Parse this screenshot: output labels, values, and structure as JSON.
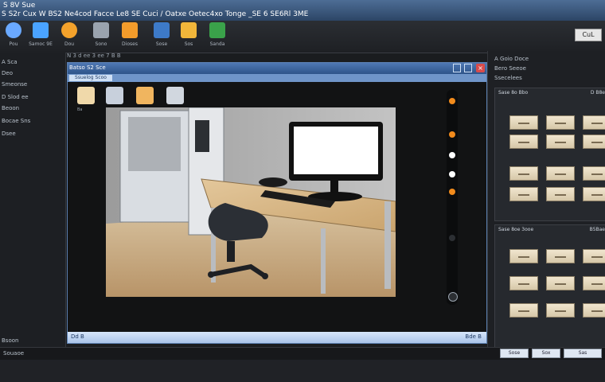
{
  "window": {
    "title": "S 8V Sue",
    "menu": "S S2r Cux W BS2 Ne4cod Facce Le8 SE Cuci / Oatxe Oetec4xo Tonge _SE 6 SE6Rl 3ME"
  },
  "toolbar": {
    "right_button": "CuL",
    "items": [
      {
        "label": "Pou",
        "icon": "globe-icon",
        "color": "#6aa9ff"
      },
      {
        "label": "Samoc 9E",
        "icon": "picture-icon",
        "color": "#4aa3ff"
      },
      {
        "label": "Dou",
        "icon": "orange-icon",
        "color": "#f4a22b"
      },
      {
        "label": "Sono",
        "icon": "printer-icon",
        "color": "#9aa3ae"
      },
      {
        "label": "Dioses",
        "icon": "chart-icon",
        "color": "#f39c2b"
      },
      {
        "label": "Sose",
        "icon": "gear-icon",
        "color": "#3d7ac8"
      },
      {
        "label": "Sos",
        "icon": "folder-icon",
        "color": "#f1b63a"
      },
      {
        "label": "Sanda",
        "icon": "screen-icon",
        "color": "#3aa24a"
      }
    ]
  },
  "subbar": {
    "text": "N 3 d ee 3 ee 7 B B"
  },
  "left_panel": {
    "items": [
      "A Sca",
      "Deo",
      "Smeonse",
      "D Slod ee",
      "Beoon",
      "Bocae Sns",
      "Dsee"
    ],
    "footer": "Bsoon"
  },
  "viewer": {
    "title": "Batso S2 Sce",
    "tab_label": "Ssuelog Scoo",
    "tool_caption": "Ba",
    "bottom_left": "Dd B",
    "bottom_right": "Bde B",
    "slider_colors": [
      "#f28b1c",
      "#f28b1c",
      "#ffffff",
      "#ffffff",
      "#f28b1c",
      "#2c2f33",
      "#2c2f33"
    ]
  },
  "right_panel": {
    "items": [
      "A Goio Doce",
      "Bero Seeoe",
      "Ssecelees"
    ],
    "panel1": {
      "title": "Sase 8o Bbo",
      "title2": "D B8e"
    },
    "panel2": {
      "title": "Sase 8oe 3ooe",
      "title2": "B5Bae"
    }
  },
  "status": {
    "left": "Souaoe",
    "right_cells": [
      "Sose",
      "Sox",
      "Sas"
    ]
  }
}
